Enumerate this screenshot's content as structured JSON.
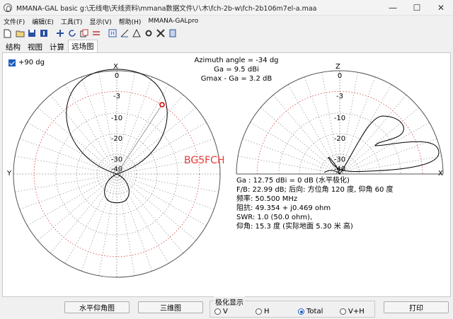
{
  "window": {
    "title": "MMANA-GAL basic g:\\无线电\\天线资料\\mmana数据文件\\八木\\fch-2b-w\\fch-2b106m7el-a.maa",
    "minimize": "—",
    "maximize": "☐",
    "close": "✕"
  },
  "menu": {
    "items": [
      "文件(F)",
      "编辑(E)",
      "工具(T)",
      "显示(V)",
      "帮助(H)",
      "MMANA-GALpro"
    ]
  },
  "toolbar": {
    "icons": [
      "new-file-icon",
      "open-folder-icon",
      "save-icon",
      "info-icon",
      "move-icon",
      "rotate-icon",
      "copy-icon",
      "equal-icon",
      "edit-icon",
      "wire-icon",
      "triangle-icon",
      "gear-icon",
      "tools-icon",
      "calculator-icon"
    ]
  },
  "tabs": [
    "结构",
    "视图",
    "计算",
    "远场图"
  ],
  "active_tab": "远场图",
  "plot": {
    "show_90": "+90 dg",
    "azimuth": "Azimuth angle = -34 dg",
    "ga": "Ga = 9.5 dBi",
    "gmax_ga": "Gmax - Ga = 3.2 dB",
    "watermark": "BG5FCH",
    "left_rings": [
      "0",
      "-3",
      "-10",
      "-20",
      "-30",
      "-40"
    ],
    "right_rings": [
      "0",
      "-3",
      "-10",
      "-20",
      "-30",
      "-40"
    ],
    "left_axis_x": "X",
    "left_axis_y": "Y",
    "right_axis_z": "Z",
    "right_axis_x": "X",
    "info_lines": [
      "Ga : 12.75 dBi = 0 dB  (水平极化)",
      "F/B: 22.99 dB; 后向: 方位角 120 度, 仰角 60 度",
      "频率: 50.500 MHz",
      "阻抗: 49.354 + j0.469 ohm",
      "SWR: 1.0 (50.0 ohm),",
      "仰角: 15.3 度 (实际地面  5.30 米 高)"
    ]
  },
  "bottom": {
    "elevation_btn": "水平仰角图",
    "three_d_btn": "三维图",
    "polarization_label": "极化显示",
    "radio_v": "V",
    "radio_h": "H",
    "radio_total": "Total",
    "radio_vh": "V+H",
    "selected": "Total",
    "print_btn": "打印"
  },
  "colors": {
    "grid_red": "#e05050",
    "grid_gray": "#a0a0a0",
    "pattern": "#000000",
    "marker": "#e00000",
    "accent": "#1e5fbf"
  }
}
